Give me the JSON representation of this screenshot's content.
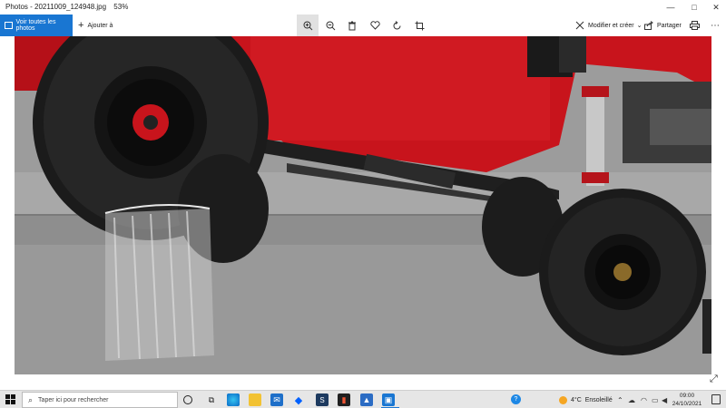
{
  "window": {
    "filename": "Photos - 20211009_124948.jpg",
    "zoom": "53%",
    "controls": {
      "minimize": "—",
      "maximize": "□",
      "close": "✕"
    }
  },
  "toolbar": {
    "view_all_label": "Voir toutes les photos",
    "add_label": "Ajouter à",
    "edit_label": "Modifier et créer",
    "share_label": "Partager",
    "tools": [
      "zoom-in-icon",
      "zoom-out-icon",
      "trash-icon",
      "heart-icon",
      "rotate-icon",
      "crop-icon"
    ]
  },
  "taskbar": {
    "search_placeholder": "Taper ici pour rechercher",
    "weather_temp": "4°C",
    "weather_text": "Ensoleillé",
    "time": "09:00",
    "date": "24/10/2021",
    "apps": [
      "task-view-icon",
      "widgets-icon",
      "edge-icon",
      "file-explorer-icon",
      "mail-icon",
      "dropbox-icon",
      "app-s-icon",
      "app-chart-icon",
      "app-word-icon",
      "photos-icon"
    ]
  },
  "colors": {
    "accent": "#1976d2",
    "car_red": "#c8141c",
    "tire": "#1b1b1b",
    "floor": "#9a9a9a"
  }
}
